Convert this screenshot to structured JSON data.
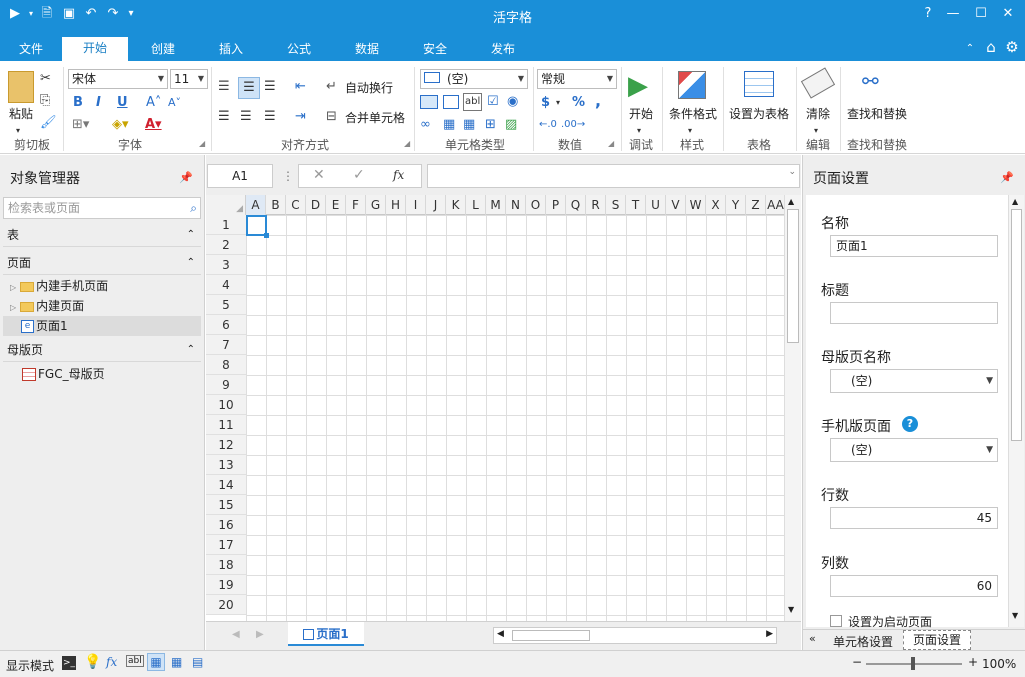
{
  "app": {
    "title": "活字格"
  },
  "tabs": [
    "文件",
    "开始",
    "创建",
    "插入",
    "公式",
    "数据",
    "安全",
    "发布"
  ],
  "active_tab": "开始",
  "ribbon": {
    "clipboard": {
      "paste": "粘贴",
      "group": "剪切板"
    },
    "font": {
      "name": "宋体",
      "size": "11",
      "bold": "B",
      "italic": "I",
      "underline": "U",
      "group": "字体"
    },
    "align": {
      "wrap": "自动换行",
      "merge": "合并单元格",
      "group": "对齐方式"
    },
    "celltype": {
      "value": "(空)",
      "group": "单元格类型"
    },
    "number": {
      "format": "常规",
      "currency": "$",
      "percent": "%",
      "comma": ",",
      "group": "数值"
    },
    "debug": {
      "start": "开始",
      "group": "调试"
    },
    "style": {
      "cond": "条件格式",
      "group": "样式"
    },
    "table": {
      "set": "设置为表格",
      "group": "表格"
    },
    "edit": {
      "clear": "清除",
      "group": "编辑"
    },
    "find": {
      "label": "查找和替换",
      "group": "查找和替换"
    }
  },
  "left_panel": {
    "title": "对象管理器",
    "search_placeholder": "检索表或页面",
    "sections": {
      "table": "表",
      "page": "页面",
      "master": "母版页"
    },
    "page_items": [
      "内建手机页面",
      "内建页面",
      "页面1"
    ],
    "master_items": [
      "FGC_母版页"
    ]
  },
  "formula": {
    "cell_ref": "A1",
    "fx": "fx"
  },
  "grid": {
    "columns": [
      "A",
      "B",
      "C",
      "D",
      "E",
      "F",
      "G",
      "H",
      "I",
      "J",
      "K",
      "L",
      "M",
      "N",
      "O",
      "P",
      "Q",
      "R",
      "S",
      "T",
      "U",
      "V",
      "W",
      "X",
      "Y",
      "Z",
      "AA"
    ],
    "rows": [
      "1",
      "2",
      "3",
      "4",
      "5",
      "6",
      "7",
      "8",
      "9",
      "10",
      "11",
      "12",
      "13",
      "14",
      "15",
      "16",
      "17",
      "18",
      "19",
      "20"
    ],
    "selected": "A1"
  },
  "sheet_tab": "页面1",
  "right_panel": {
    "title": "页面设置",
    "name_label": "名称",
    "name_value": "页面1",
    "caption_label": "标题",
    "caption_value": "",
    "master_label": "母版页名称",
    "master_value": "(空)",
    "mobile_label": "手机版页面",
    "mobile_value": "(空)",
    "rows_label": "行数",
    "rows_value": "45",
    "cols_label": "列数",
    "cols_value": "60",
    "startup_label": "设置为启动页面",
    "bottom_tabs": [
      "单元格设置",
      "页面设置"
    ]
  },
  "status": {
    "mode": "显示模式",
    "zoom": "100%"
  }
}
